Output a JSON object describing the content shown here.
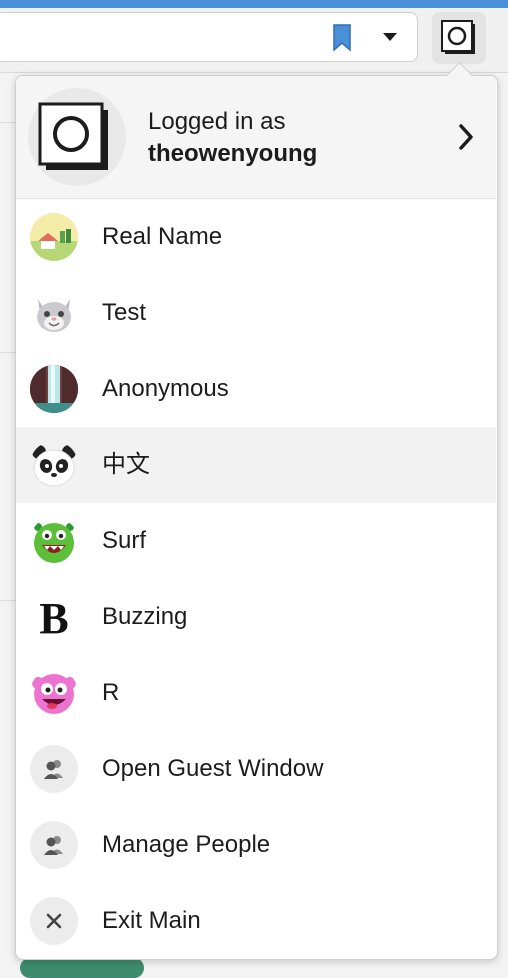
{
  "toolbar": {
    "bookmark_icon": "bookmark-icon",
    "dropdown_icon": "caret-down-icon",
    "profile_icon": "profile-logo-icon",
    "bookmark_color": "#4a90d9"
  },
  "menu": {
    "header": {
      "logged_in_label": "Logged in as",
      "username": "theowenyoung",
      "chevron_icon": "chevron-right-icon"
    },
    "items": [
      {
        "label": "Real Name",
        "icon": "landscape-avatar-icon"
      },
      {
        "label": "Test",
        "icon": "cat-avatar-icon"
      },
      {
        "label": "Anonymous",
        "icon": "waterfall-avatar-icon"
      },
      {
        "label": "中文",
        "icon": "panda-avatar-icon"
      },
      {
        "label": "Surf",
        "icon": "green-monster-avatar-icon"
      },
      {
        "label": "Buzzing",
        "icon": "letter-b-avatar-icon"
      },
      {
        "label": "R",
        "icon": "pink-monster-avatar-icon"
      },
      {
        "label": "Open Guest Window",
        "icon": "guest-person-icon"
      },
      {
        "label": "Manage People",
        "icon": "manage-people-icon"
      },
      {
        "label": "Exit Main",
        "icon": "close-icon"
      }
    ]
  }
}
